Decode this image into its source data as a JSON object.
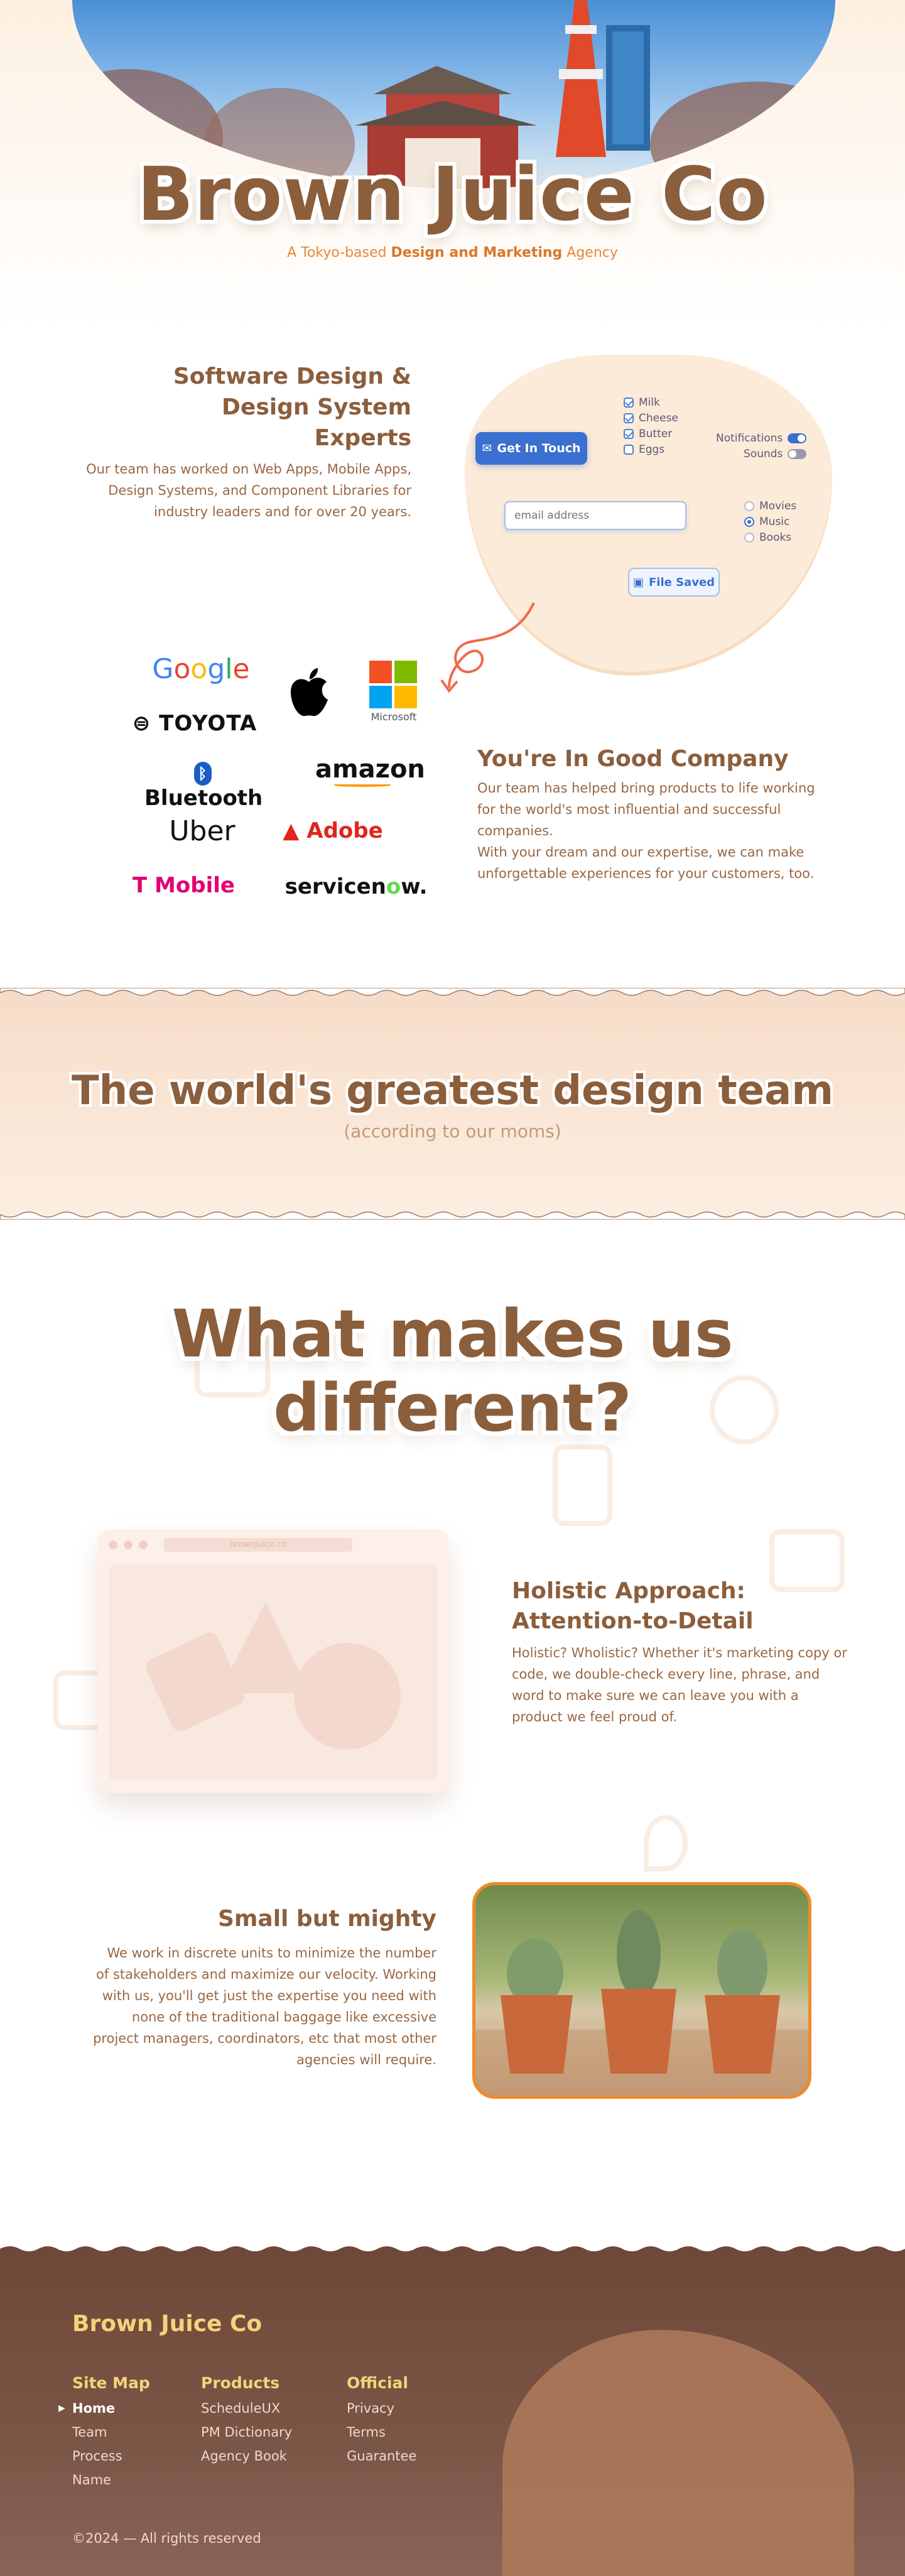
{
  "hero": {
    "title": "Brown Juice Co",
    "subtitle_pre": "A Tokyo-based ",
    "subtitle_bold": "Design and Marketing",
    "subtitle_post": " Agency"
  },
  "software": {
    "heading_line1": "Software Design &",
    "heading_line2": "Design System",
    "heading_line3": "Experts",
    "body": "Our team has worked on Web Apps, Mobile Apps, Design Systems, and Component Libraries for industry leaders and for over 20 years."
  },
  "ui_demo": {
    "button_label": "Get In Touch",
    "checkboxes": [
      {
        "label": "Milk",
        "checked": true
      },
      {
        "label": "Cheese",
        "checked": true
      },
      {
        "label": "Butter",
        "checked": true
      },
      {
        "label": "Eggs",
        "checked": false
      }
    ],
    "toggles": [
      {
        "label": "Notifications",
        "on": true
      },
      {
        "label": "Sounds",
        "on": false
      }
    ],
    "email_placeholder": "email address",
    "radios": [
      {
        "label": "Movies",
        "selected": false
      },
      {
        "label": "Music",
        "selected": true
      },
      {
        "label": "Books",
        "selected": false
      }
    ],
    "saved_label": "File Saved"
  },
  "logos": [
    "Google",
    "Apple",
    "Microsoft",
    "TOYOTA",
    "Bluetooth",
    "amazon",
    "Uber",
    "Adobe",
    "T Mobile",
    "servicenow."
  ],
  "company": {
    "heading": "You're In Good Company",
    "body1": "Our team has helped bring products to life working for the world's most influential and successful companies.",
    "body2": "With your dream and our expertise, we can make unforgettable experiences for your customers, too."
  },
  "band": {
    "title": "The world's greatest design team",
    "subtitle": "(according to our moms)"
  },
  "different": {
    "title_line1": "What makes us",
    "title_line2": "different?"
  },
  "holistic": {
    "browser_url": "brownjuice.co",
    "heading_line1": "Holistic Approach:",
    "heading_line2": "Attention-to-Detail",
    "body": "Holistic? Wholistic? Whether it's marketing copy or code, we double-check every line, phrase, and word to make sure we can leave you with a product we feel proud of."
  },
  "small": {
    "heading": "Small but mighty",
    "body": "We work in discrete units to minimize the number of stakeholders and maximize our velocity. Working with us, you'll get just the expertise you need with none of the traditional baggage like excessive project managers, coordinators, etc that most other agencies will require."
  },
  "footer": {
    "brand": "Brown Juice Co",
    "sitemap_heading": "Site Map",
    "sitemap": [
      "Home",
      "Team",
      "Process",
      "Name"
    ],
    "products_heading": "Products",
    "products": [
      "ScheduleUX",
      "PM Dictionary",
      "Agency Book"
    ],
    "official_heading": "Official",
    "official": [
      "Privacy",
      "Terms",
      "Guarantee"
    ],
    "copyright": "©2024 — All rights reserved"
  },
  "colors": {
    "brown": "#8b5e3c",
    "orange": "#e8873a",
    "blue": "#3b6fd0",
    "footer_bg": "#6f4737",
    "footer_heading": "#f5d27a"
  }
}
